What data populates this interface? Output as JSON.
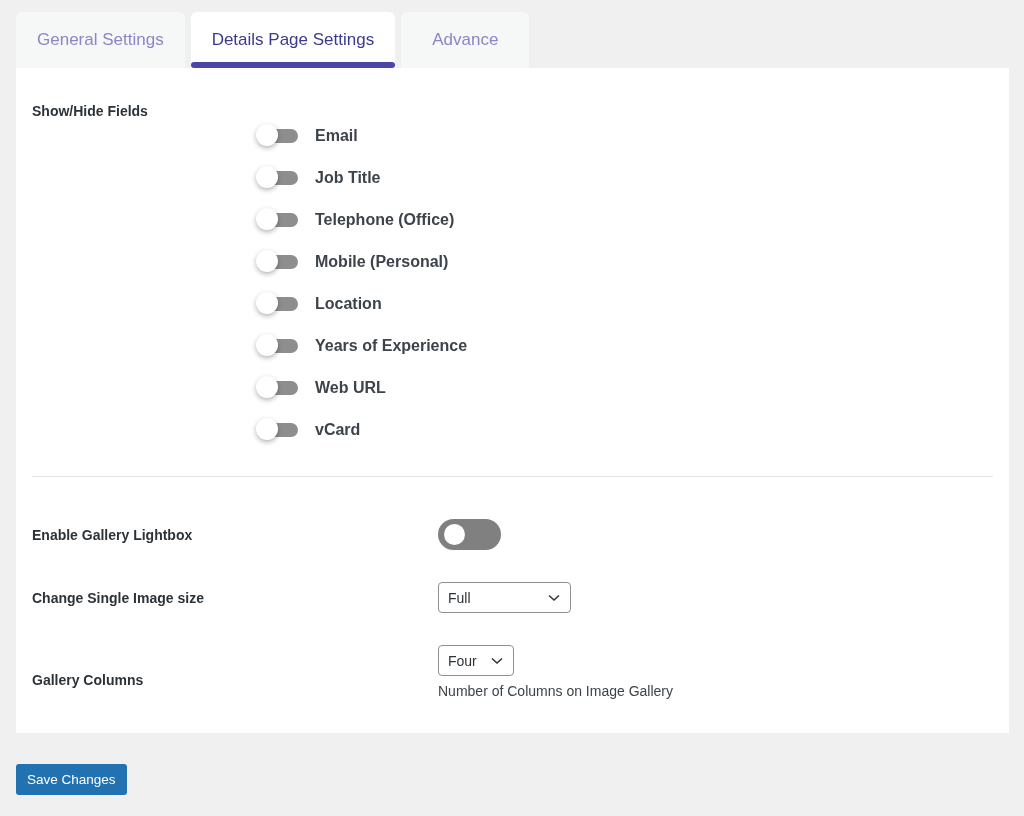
{
  "tabs": [
    {
      "label": "General Settings",
      "selected": false
    },
    {
      "label": "Details Page Settings",
      "selected": true
    },
    {
      "label": "Advance",
      "selected": false
    }
  ],
  "show_hide_fields": {
    "label": "Show/Hide Fields",
    "fields": [
      {
        "label": "Email",
        "on": false
      },
      {
        "label": "Job Title",
        "on": false
      },
      {
        "label": "Telephone (Office)",
        "on": false
      },
      {
        "label": "Mobile (Personal)",
        "on": false
      },
      {
        "label": "Location",
        "on": false
      },
      {
        "label": "Years of Experience",
        "on": false
      },
      {
        "label": "Web URL",
        "on": false
      },
      {
        "label": "vCard",
        "on": false
      }
    ]
  },
  "settings": [
    {
      "kind": "toggle",
      "label": "Enable Gallery Lightbox",
      "on": false
    },
    {
      "kind": "select",
      "label": "Change Single Image size",
      "value": "Full"
    },
    {
      "kind": "select",
      "label": "Gallery Columns",
      "value": "Four",
      "description": "Number of Columns on Image Gallery"
    }
  ],
  "save_button": "Save Changes"
}
